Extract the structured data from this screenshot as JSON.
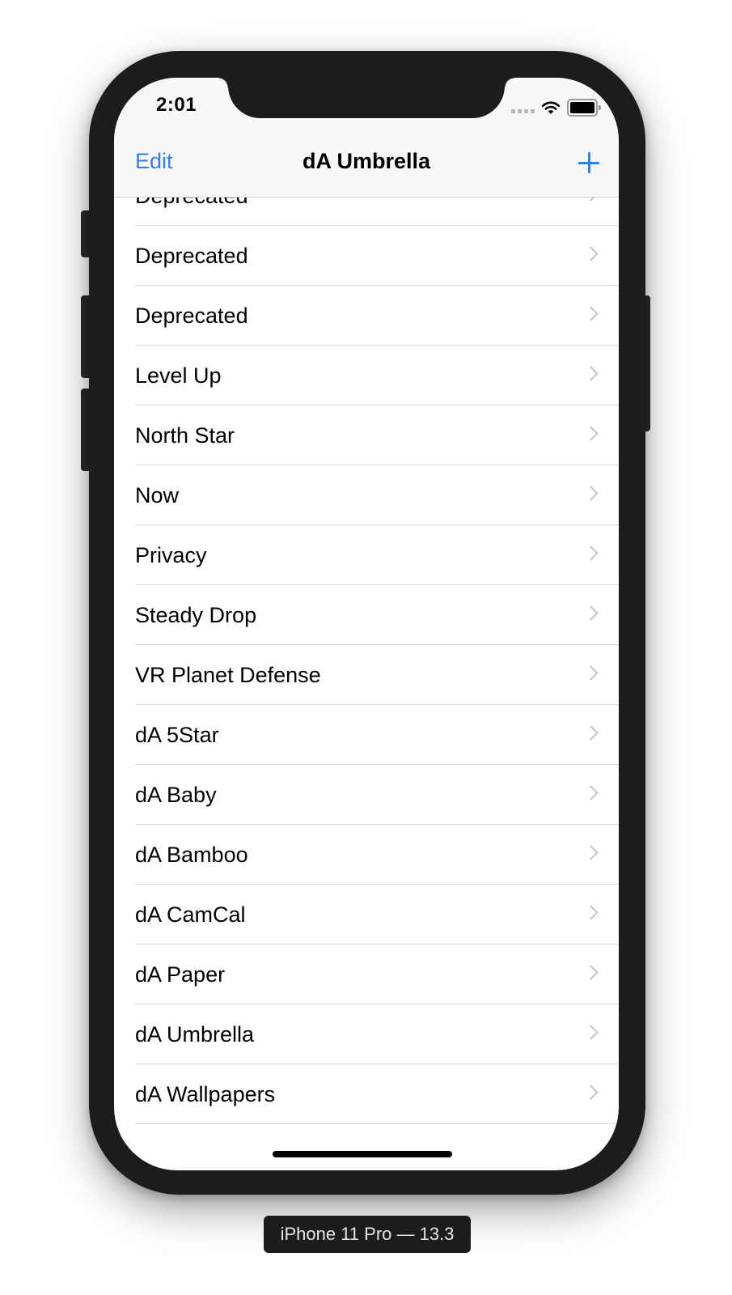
{
  "status_bar": {
    "time": "2:01",
    "signal_icon": "cellular-signal-dots-icon",
    "wifi_icon": "wifi-icon",
    "battery_icon": "battery-full-icon"
  },
  "nav_bar": {
    "edit_label": "Edit",
    "title": "dA Umbrella",
    "add_icon": "plus-icon"
  },
  "list": {
    "items": [
      {
        "label": "Deprecated"
      },
      {
        "label": "Deprecated"
      },
      {
        "label": "Deprecated"
      },
      {
        "label": "Level Up"
      },
      {
        "label": "North Star"
      },
      {
        "label": "Now"
      },
      {
        "label": "Privacy"
      },
      {
        "label": "Steady Drop"
      },
      {
        "label": "VR Planet Defense"
      },
      {
        "label": "dA 5Star"
      },
      {
        "label": "dA Baby"
      },
      {
        "label": "dA Bamboo"
      },
      {
        "label": "dA CamCal"
      },
      {
        "label": "dA Paper"
      },
      {
        "label": "dA Umbrella"
      },
      {
        "label": "dA Wallpapers"
      }
    ],
    "row_accessory_icon": "chevron-right-icon"
  },
  "simulator": {
    "device_label": "iPhone 11 Pro — 13.3"
  },
  "colors": {
    "accent": "#2f7ff0",
    "nav_background": "#f8f8f8",
    "separator": "#dcdcdc",
    "chevron": "#c4c4c9",
    "device_frame": "#1c1c1c"
  }
}
